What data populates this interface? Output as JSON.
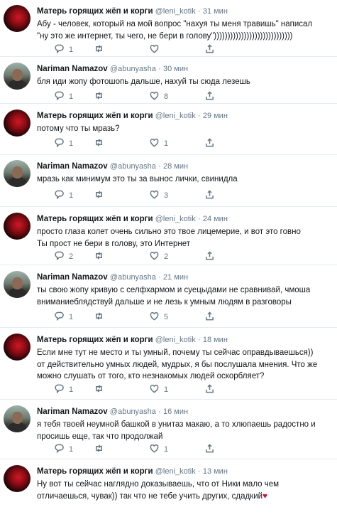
{
  "tweets": [
    {
      "name": "Матерь горящих жёп и корги",
      "handle": "@leni_kotik",
      "time": "31 мин",
      "lines": [
        "Абу - человек, который на мой вопрос \"нахуя ты меня травишь\" написал",
        "\"ну это же интернет, ты чего, не бери в голову\")))))))))))))))))))))))))))))"
      ],
      "replies": "1",
      "retweets": "",
      "likes": ""
    },
    {
      "name": "Nariman Namazov",
      "handle": "@abunyasha",
      "time": "30 мин",
      "lines": [
        "бля иди жопу фотошопь дальше, нахуй ты сюда лезешь"
      ],
      "replies": "1",
      "retweets": "",
      "likes": "8"
    },
    {
      "name": "Матерь горящих жёп и корги",
      "handle": "@leni_kotik",
      "time": "29 мин",
      "lines": [
        "потому что ты мразь?"
      ],
      "replies": "1",
      "retweets": "",
      "likes": "1"
    },
    {
      "name": "Nariman Namazov",
      "handle": "@abunyasha",
      "time": "28 мин",
      "lines": [
        "мразь как минимум это ты за вынос лички, свинидла"
      ],
      "replies": "1",
      "retweets": "",
      "likes": "3"
    },
    {
      "name": "Матерь горящих жёп и корги",
      "handle": "@leni_kotik",
      "time": "24 мин",
      "lines": [
        "просто глаза колет очень сильно это твое лицемерие, и вот это говно",
        "Ты прост не бери в голову, это Интернет"
      ],
      "replies": "2",
      "retweets": "",
      "likes": "2"
    },
    {
      "name": "Nariman Namazov",
      "handle": "@abunyasha",
      "time": "21 мин",
      "lines": [
        "ты свою жопу кривую с селфхармом и суецыдами не сравнивай, чмоша",
        "вниманиеблядствуй дальше и не лезь к умным людям в разговоры"
      ],
      "replies": "1",
      "retweets": "",
      "likes": "5"
    },
    {
      "name": "Матерь горящих жёп и корги",
      "handle": "@leni_kotik",
      "time": "18 мин",
      "lines": [
        "Если мне тут не место и ты умный, почему ты сейчас оправдываешься))",
        "от действительно умных людей, мудрых, я бы послушала мнения. Что же",
        "можно слушать от того, кто незнакомых людей оскорбляет?"
      ],
      "replies": "1",
      "retweets": "",
      "likes": "1"
    },
    {
      "name": "Nariman Namazov",
      "handle": "@abunyasha",
      "time": "16 мин",
      "lines": [
        "я тебя твоей неумной башкой в унитаз макаю, а то хлюпаешь радостно и",
        "просишь еще, так что продолжай"
      ],
      "replies": "1",
      "retweets": "",
      "likes": "1"
    },
    {
      "name": "Матерь горящих жёп и корги",
      "handle": "@leni_kotik",
      "time": "13 мин",
      "lines": [
        "Ну вот ты сейчас наглядно доказываешь, что от Ники мало чем",
        "отличаешься, чувак)) так что не тебе учить других, сдадкий"
      ],
      "heart": "♥",
      "replies": "",
      "retweets": "",
      "likes": ""
    }
  ],
  "colors": {
    "text": "#14171a",
    "muted": "#657786",
    "divider": "#e6ecf0",
    "heart": "#d0103a"
  },
  "icons": {
    "reply": "reply-icon",
    "retweet": "retweet-icon",
    "like": "heart-icon",
    "share": "share-icon"
  }
}
